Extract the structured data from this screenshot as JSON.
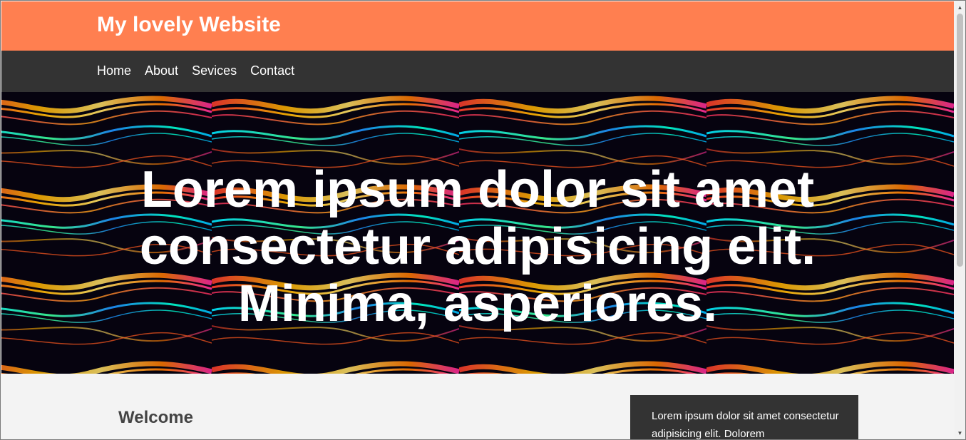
{
  "header": {
    "title": "My lovely Website"
  },
  "nav": {
    "items": [
      {
        "label": "Home"
      },
      {
        "label": "About"
      },
      {
        "label": "Sevices"
      },
      {
        "label": "Contact"
      }
    ]
  },
  "hero": {
    "title": "Lorem ipsum dolor sit amet consectetur adipisicing elit. Minima, asperiores."
  },
  "main": {
    "welcome_heading": "Welcome"
  },
  "sidebar": {
    "text": "Lorem ipsum dolor sit amet consectetur adipisicing elit. Dolorem"
  },
  "colors": {
    "header_bg": "#ff7f50",
    "nav_bg": "#333333",
    "content_bg": "#f3f3f3",
    "sidebar_bg": "#333333"
  },
  "scrollbar": {
    "up_icon": "arrow-up-icon",
    "down_icon": "arrow-down-icon"
  }
}
